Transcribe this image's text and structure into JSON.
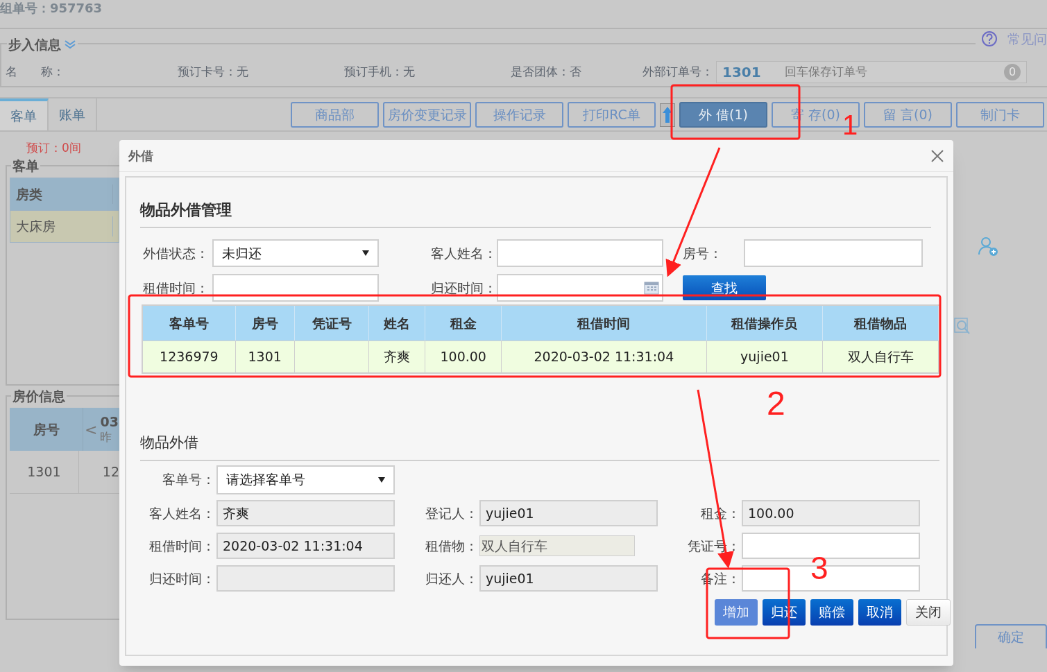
{
  "header": {
    "order_no": "组单号：957763"
  },
  "walk_in": {
    "title": "步入信息",
    "help": "常见问",
    "fields": [
      "名　　称：",
      "预订卡号：无",
      "预订手机：无",
      "是否团体：否"
    ],
    "external_order": {
      "label": "外部订单号：",
      "value": "1301",
      "placeholder": "回车保存订单号",
      "count": "0"
    }
  },
  "tabs": [
    {
      "label": "客单",
      "selected": true
    },
    {
      "label": "账单",
      "selected": false
    }
  ],
  "toolbar": [
    {
      "label": "商品部",
      "selected": false
    },
    {
      "label": "房价变更记录",
      "selected": false
    },
    {
      "label": "操作记录",
      "selected": false
    },
    {
      "label": "打印RC单",
      "selected": false
    },
    {
      "label": "外 借(1)",
      "selected": true
    },
    {
      "label": "寄 存(0)",
      "selected": false
    },
    {
      "label": "留 言(0)",
      "selected": false
    },
    {
      "label": "制门卡",
      "selected": false
    }
  ],
  "booking": "预订：0间",
  "guest_panel": {
    "title": "客单",
    "columns": [
      "房类"
    ],
    "rows": [
      [
        "大床房"
      ]
    ]
  },
  "price_panel": {
    "title": "房价信息",
    "columns": [
      "房号",
      "03"
    ],
    "prev": "<",
    "date_sub": "昨",
    "rows": [
      [
        "1301",
        "12"
      ]
    ]
  },
  "confirm": "确定",
  "dialog": {
    "title": "外借",
    "manage_title": "物品外借管理",
    "filters": [
      {
        "label": "外借状态：",
        "kind": "select",
        "value": "未归还"
      },
      {
        "label": "客人姓名：",
        "kind": "input"
      },
      {
        "label": "房号：",
        "kind": "input"
      },
      {
        "label": "租借时间：",
        "kind": "input"
      },
      {
        "label": "归还时间：",
        "kind": "date"
      }
    ],
    "search": "查找",
    "table": {
      "columns": [
        "客单号",
        "房号",
        "凭证号",
        "姓名",
        "租金",
        "租借时间",
        "租借操作员",
        "租借物品"
      ],
      "rows": [
        [
          "1236979",
          "1301",
          "",
          "齐爽",
          "100.00",
          "2020-03-02 11:31:04",
          "yujie01",
          "双人自行车"
        ]
      ]
    },
    "form_title": "物品外借",
    "form": [
      {
        "label": "客单号：",
        "kind": "select",
        "value": "请选择客单号"
      },
      {
        "label": "客人姓名：",
        "kind": "input",
        "value": "齐爽",
        "readonly": true
      },
      {
        "label": "登记人：",
        "kind": "input",
        "value": "yujie01",
        "readonly": true
      },
      {
        "label": "租金：",
        "kind": "input",
        "value": "100.00",
        "readonly": true
      },
      {
        "label": "租借时间：",
        "kind": "input",
        "value": "2020-03-02 11:31:04",
        "readonly": true
      },
      {
        "label": "租借物：",
        "kind": "item",
        "value": "双人自行车",
        "readonly": true
      },
      {
        "label": "凭证号：",
        "kind": "input",
        "readonly": false
      },
      {
        "label": "归还时间：",
        "kind": "input",
        "readonly": true
      },
      {
        "label": "归还人：",
        "kind": "input",
        "value": "yujie01",
        "readonly": true
      },
      {
        "label": "备注：",
        "kind": "input",
        "readonly": false
      }
    ],
    "buttons": [
      {
        "label": "增加",
        "kind": "primary",
        "disabled": true
      },
      {
        "label": "归还",
        "kind": "primary",
        "disabled": false
      },
      {
        "label": "赔偿",
        "kind": "primary",
        "disabled": false
      },
      {
        "label": "取消",
        "kind": "primary",
        "disabled": false
      },
      {
        "label": "关闭",
        "kind": "plain"
      }
    ]
  },
  "annotations": [
    "1",
    "2",
    "3"
  ]
}
